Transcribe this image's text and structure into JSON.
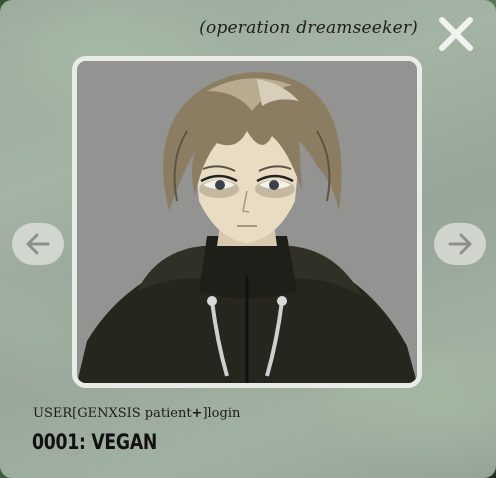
{
  "window": {
    "title": "(operation dreamseeker)"
  },
  "portrait": {
    "character_description": ""
  },
  "navigation": {
    "prev_icon": "arrow-left-icon",
    "next_icon": "arrow-right-icon",
    "close_icon": "close-x-icon"
  },
  "login": {
    "prefix": "USER[GENXSIS patient",
    "plus": "+",
    "suffix": "]login"
  },
  "user": {
    "name": "0001: VEGAN"
  },
  "colors": {
    "panel": "#b9c4ba",
    "frame": "#e9ece6",
    "accent_green": "#5b7a55",
    "text": "#1c1c1c"
  }
}
